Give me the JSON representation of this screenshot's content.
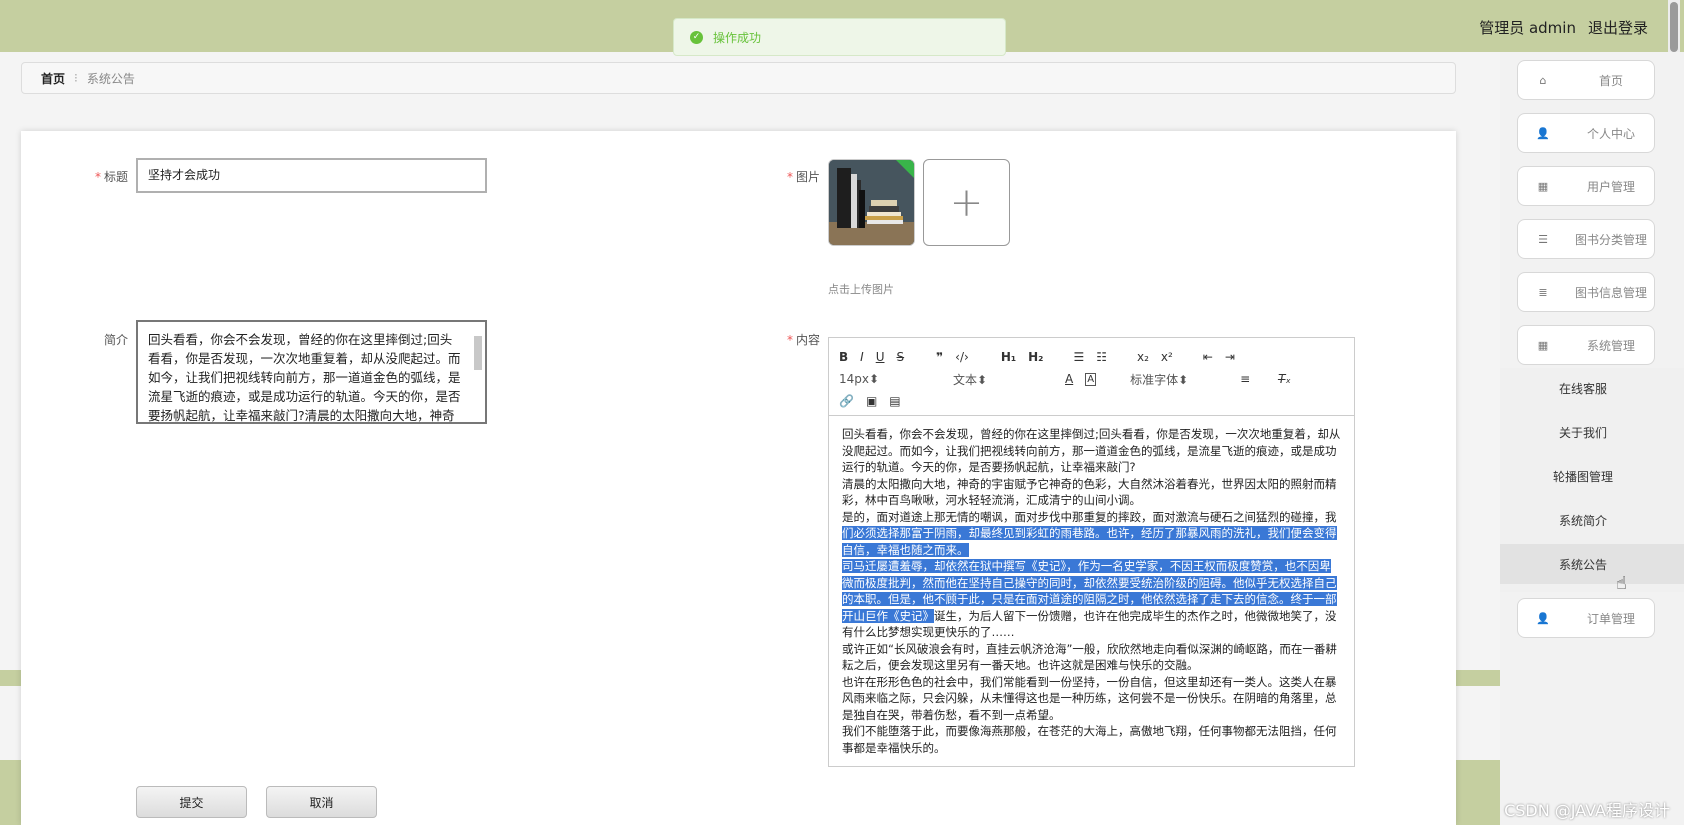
{
  "header": {
    "toast": "操作成功",
    "user_label": "管理员 admin",
    "logout": "退出登录"
  },
  "breadcrumb": {
    "home": "首页",
    "current": "系统公告"
  },
  "form": {
    "title_label": "标题",
    "title_value": "坚持才会成功",
    "image_label": "图片",
    "upload_tip": "点击上传图片",
    "summary_label": "简介",
    "summary_value": "回头看看，你会不会发现，曾经的你在这里摔倒过;回头看看，你是否发现，一次次地重复着，却从没爬起过。而如今，让我们把视线转向前方，那一道道金色的弧线，是流星飞逝的痕迹，或是成功运行的轨道。今天的你，是否要扬帆起航，让幸福来敲门?清晨的太阳撒向大地，神奇",
    "content_label": "内容",
    "submit": "提交",
    "cancel": "取消"
  },
  "editor": {
    "font_size": "14px",
    "block_type": "文本",
    "font_family": "标准字体",
    "paragraphs": [
      {
        "text": "回头看看，你会不会发现，曾经的你在这里摔倒过;回头看看，你是否发现，一次次地重复着，却从没爬起过。而如今，让我们把视线转向前方，那一道道金色的弧线，是流星飞逝的痕迹，或是成功运行的轨道。今天的你，是否要扬帆起航，让幸福来敲门?"
      },
      {
        "text": "清晨的太阳撒向大地，神奇的宇宙赋予它神奇的色彩，大自然沐浴着春光，世界因太阳的照射而精彩，林中百鸟啾啾，河水轻轻流淌，汇成清宁的山间小调。"
      },
      {
        "text": "是的，面对道途上那无情的嘲讽，面对步伐中那重复的摔跤，面对激流与硬石之间猛烈的碰撞，我",
        "highlight": "们必须选择那富于阴雨，却最终见到彩虹的雨巷路。也许，经历了那暴风雨的洗礼，我们便会变得自信，幸福也随之而来。"
      },
      {
        "highlight": "司马迁屡遭羞辱，却依然在狱中撰写《史记》，作为一名史学家，不因王权而极度赞赏，也不因卑微而极度批判，然而他在坚持自己操守的同时，却依然要受统治阶级的阻碍。他似乎无权选择自己的本职。但是，他不顾于此，只是在面对道途的阻隔之时，他依然选择了走下去的信念。终于一部开山巨作《史记》",
        "text": "诞生，为后人留下一份馈赠，也许在他完成毕生的杰作之时，他微微地笑了，没有什么比梦想实现更快乐的了……"
      },
      {
        "text": "或许正如“长风破浪会有时，直挂云帆济沧海”一般，欣欣然地走向看似深渊的崎岖路，而在一番耕耘之后，便会发现这里另有一番天地。也许这就是困难与快乐的交融。"
      },
      {
        "text": "也许在形形色色的社会中，我们常能看到一份坚持，一份自信，但这里却还有一类人。这类人在暴风雨来临之际，只会闪躲，从未懂得这也是一种历练，这何尝不是一份快乐。在阴暗的角落里，总是独自在哭，带着伤愁，看不到一点希望。"
      },
      {
        "text": "我们不能堕落于此，而要像海燕那般，在苍茫的大海上，高傲地飞翔，任何事物都无法阻挡，任何事都是幸福快乐的。"
      }
    ]
  },
  "sidebar": {
    "items": [
      {
        "label": "首页",
        "icon": "home-icon"
      },
      {
        "label": "个人中心",
        "icon": "user-icon"
      },
      {
        "label": "用户管理",
        "icon": "grid-icon"
      },
      {
        "label": "图书分类管理",
        "icon": "sliders-icon"
      },
      {
        "label": "图书信息管理",
        "icon": "list-icon"
      },
      {
        "label": "系统管理",
        "icon": "grid-icon"
      },
      {
        "label": "订单管理",
        "icon": "user-icon"
      }
    ],
    "submenu": [
      "在线客服",
      "关于我们",
      "轮播图管理",
      "系统简介",
      "系统公告"
    ]
  },
  "watermark": "CSDN @JAVA程序设计",
  "colors": {
    "header_bg": "#c5cfa0",
    "success": "#67c23a",
    "selection": "#3a78d6"
  }
}
